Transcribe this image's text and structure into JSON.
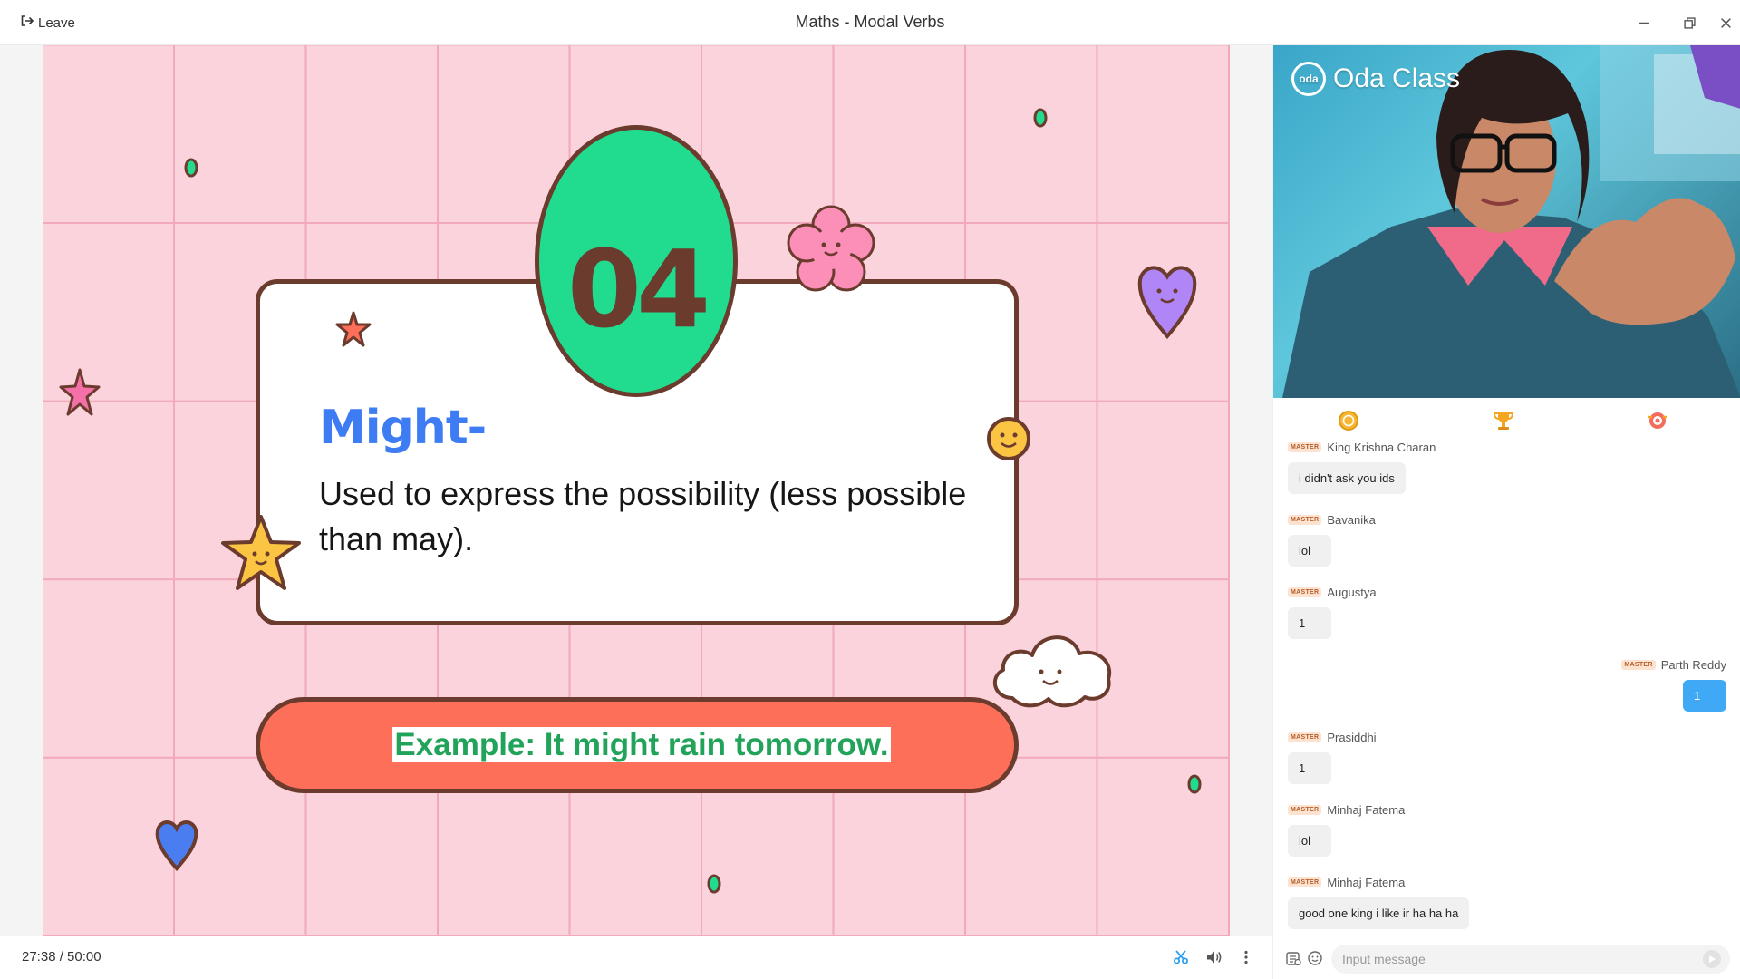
{
  "window": {
    "title": "Maths - Modal Verbs",
    "leave_label": "Leave"
  },
  "slide": {
    "number": "04",
    "heading": "Might-",
    "body": "Used to express the possibility (less possible than may).",
    "example": "Example:  It might rain tomorrow.",
    "colors": {
      "background": "#fbd3dc",
      "grid": "#f2a9bb",
      "heading": "#3d7cf2",
      "pill": "#fd6f58",
      "blob": "#21dc8f",
      "outline": "#6b3b2e",
      "example_text": "#21a35a"
    }
  },
  "player": {
    "time_current": "27:38",
    "time_total": "/ 50:00",
    "icons": [
      "scissors-icon",
      "volume-icon",
      "more-vertical-icon"
    ]
  },
  "video": {
    "brand_logo_text": "oda",
    "brand": "Oda Class"
  },
  "tabs": [
    {
      "name": "coins-tab",
      "icon": "coin-icon"
    },
    {
      "name": "leaderboard-tab",
      "icon": "trophy-icon"
    },
    {
      "name": "rewards-tab",
      "icon": "badge-icon"
    }
  ],
  "chat": {
    "badge_label": "MASTER",
    "messages": [
      {
        "user": "King Krishna Charan",
        "text": "i didn't ask you ids",
        "self": false
      },
      {
        "user": "Bavanika",
        "text": "lol",
        "self": false
      },
      {
        "user": "Augustya",
        "text": "1",
        "self": false
      },
      {
        "user": "Parth Reddy",
        "text": "1",
        "self": true
      },
      {
        "user": "Prasiddhi",
        "text": "1",
        "self": false
      },
      {
        "user": "Minhaj Fatema",
        "text": "lol",
        "self": false
      },
      {
        "user": "Minhaj Fatema",
        "text": "good one king i like ir ha ha ha",
        "self": false
      }
    ],
    "input_placeholder": "Input message"
  }
}
